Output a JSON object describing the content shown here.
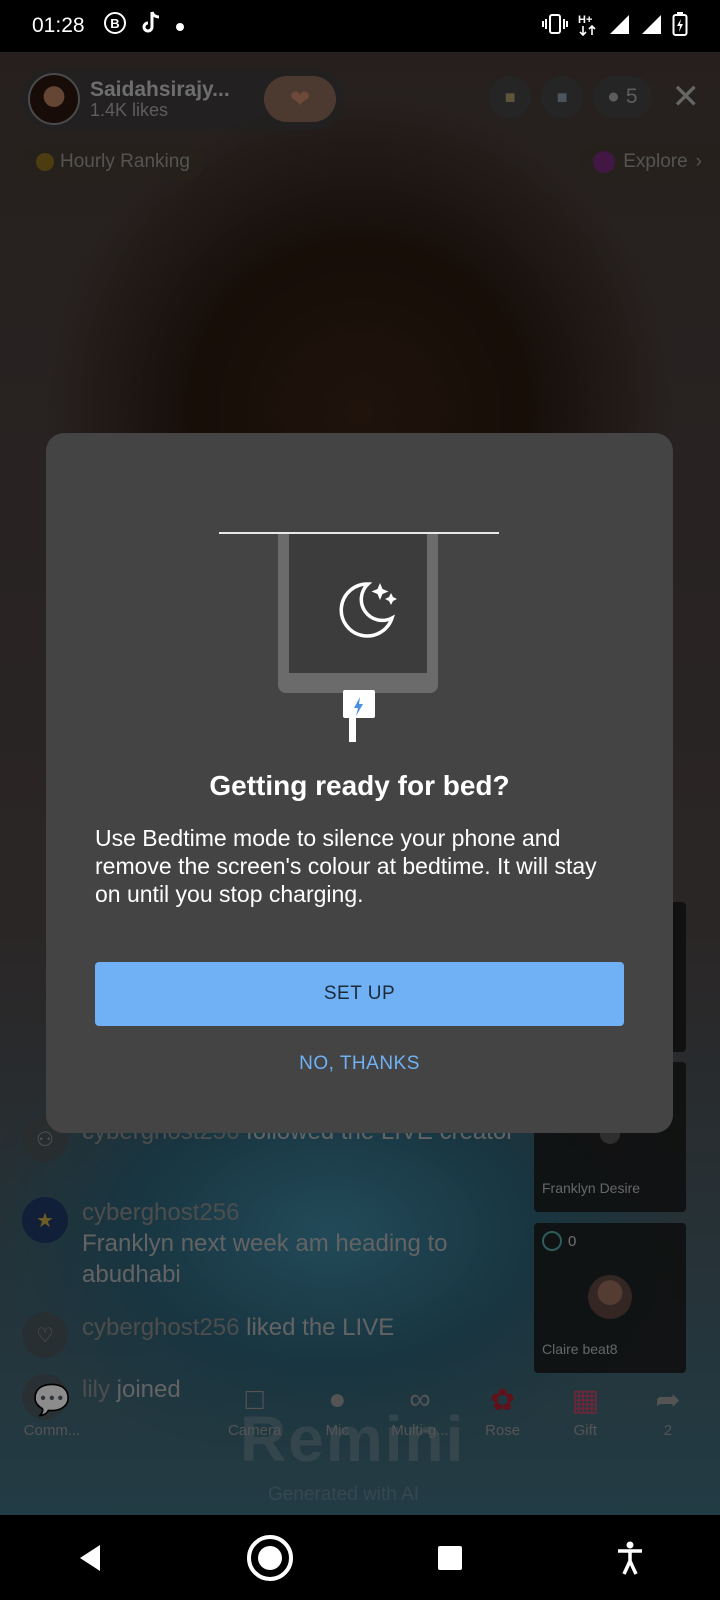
{
  "status_bar": {
    "time": "01:28",
    "icons": [
      "b-badge-icon",
      "tiktok-icon",
      "dot-icon",
      "vibrate-icon",
      "data-icon",
      "signal-icon",
      "signal-icon",
      "battery-charging-icon"
    ]
  },
  "live": {
    "host_name": "Saidahsirajy...",
    "host_likes": "1.4K likes",
    "viewer_count": "5",
    "hourly_ranking": "Hourly Ranking",
    "explore": "Explore",
    "cards": [
      {
        "name": "Franklyn Desire"
      },
      {
        "name": "Claire beat8",
        "badge": "0"
      }
    ],
    "chat": [
      {
        "user": "cyberghost256",
        "text": "followed the LIVE creator"
      },
      {
        "user": "cyberghost256",
        "text": "Franklyn next week am heading to abudhabi"
      },
      {
        "user": "cyberghost256",
        "text": "liked the LIVE"
      },
      {
        "user": "lily",
        "text": "joined"
      }
    ],
    "bottom_bar": [
      {
        "label": "Comm..."
      },
      {
        "label": "Camera"
      },
      {
        "label": "Mic"
      },
      {
        "label": "Multi-g..."
      },
      {
        "label": "Rose"
      },
      {
        "label": "Gift"
      },
      {
        "label": "2"
      }
    ],
    "watermark": "Remini",
    "watermark_sub": "Generated with AI"
  },
  "dialog": {
    "title": "Getting ready for bed?",
    "body": "Use Bedtime mode to silence your phone and remove the screen's colour at bedtime. It will stay on until you stop charging.",
    "primary_button": "SET UP",
    "secondary_button": "NO, THANKS",
    "accent": "#6fb1f4"
  }
}
